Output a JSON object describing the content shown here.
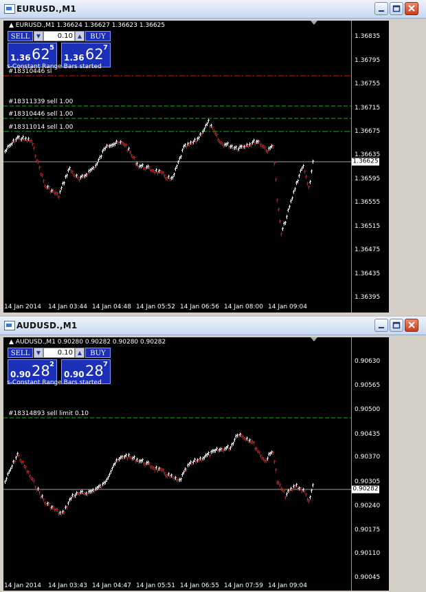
{
  "windows": [
    {
      "title": "EURUSD.,M1",
      "symbol_line": "EURUSD.,M1  1.36624 1.36627 1.36623 1.36625",
      "trade_panel": {
        "sell_label": "SELL",
        "buy_label": "BUY",
        "volume": "0.10",
        "bid_big": "1.36",
        "bid_main": "62",
        "bid_pip": "5",
        "ask_big": "1.36",
        "ask_main": "62",
        "ask_pip": "7"
      },
      "status_text": "s-Constant Range Bars started",
      "y_ticks": [
        "1.36835",
        "1.36795",
        "1.36755",
        "1.36715",
        "1.36675",
        "1.36635",
        "1.36595",
        "1.36555",
        "1.36515",
        "1.36475",
        "1.36435",
        "1.36395"
      ],
      "current_price": "1.36625",
      "x_ticks": [
        "14 Jan 2014",
        "14 Jan 03:44",
        "14 Jan 04:48",
        "14 Jan 05:52",
        "14 Jan 06:56",
        "14 Jan 08:00",
        "14 Jan 09:04"
      ],
      "order_labels": [
        "#18310446 sl",
        "#18311339 sell 1.00",
        "#18310446 sell 1.00",
        "#18311014 sell 1.00"
      ],
      "colors": {
        "up": "#ffffff",
        "down": "#ff0000",
        "sl_line": "#ff0000",
        "order_line": "#00c000",
        "bid_line": "#a0a0a0",
        "panel": "#1c2fb8"
      }
    },
    {
      "title": "AUDUSD.,M1",
      "symbol_line": "AUDUSD.,M1  0.90280 0.90282 0.90280 0.90282",
      "trade_panel": {
        "sell_label": "SELL",
        "buy_label": "BUY",
        "volume": "0.10",
        "bid_big": "0.90",
        "bid_main": "28",
        "bid_pip": "2",
        "ask_big": "0.90",
        "ask_main": "28",
        "ask_pip": "7"
      },
      "status_text": "s-Constant Range Bars started",
      "y_ticks": [
        "0.90630",
        "0.90565",
        "0.90500",
        "0.90435",
        "0.90370",
        "0.90305",
        "0.90240",
        "0.90175",
        "0.90110",
        "0.90045"
      ],
      "current_price": "0.90282",
      "x_ticks": [
        "14 Jan 2014",
        "14 Jan 03:43",
        "14 Jan 04:47",
        "14 Jan 05:51",
        "14 Jan 06:55",
        "14 Jan 07:59",
        "14 Jan 09:04"
      ],
      "order_labels": [
        "#18314893 sell limit 0.10"
      ],
      "colors": {
        "up": "#ffffff",
        "down": "#ff0000",
        "order_line": "#00c000",
        "bid_line": "#a0a0a0",
        "panel": "#1c2fb8"
      }
    }
  ]
}
